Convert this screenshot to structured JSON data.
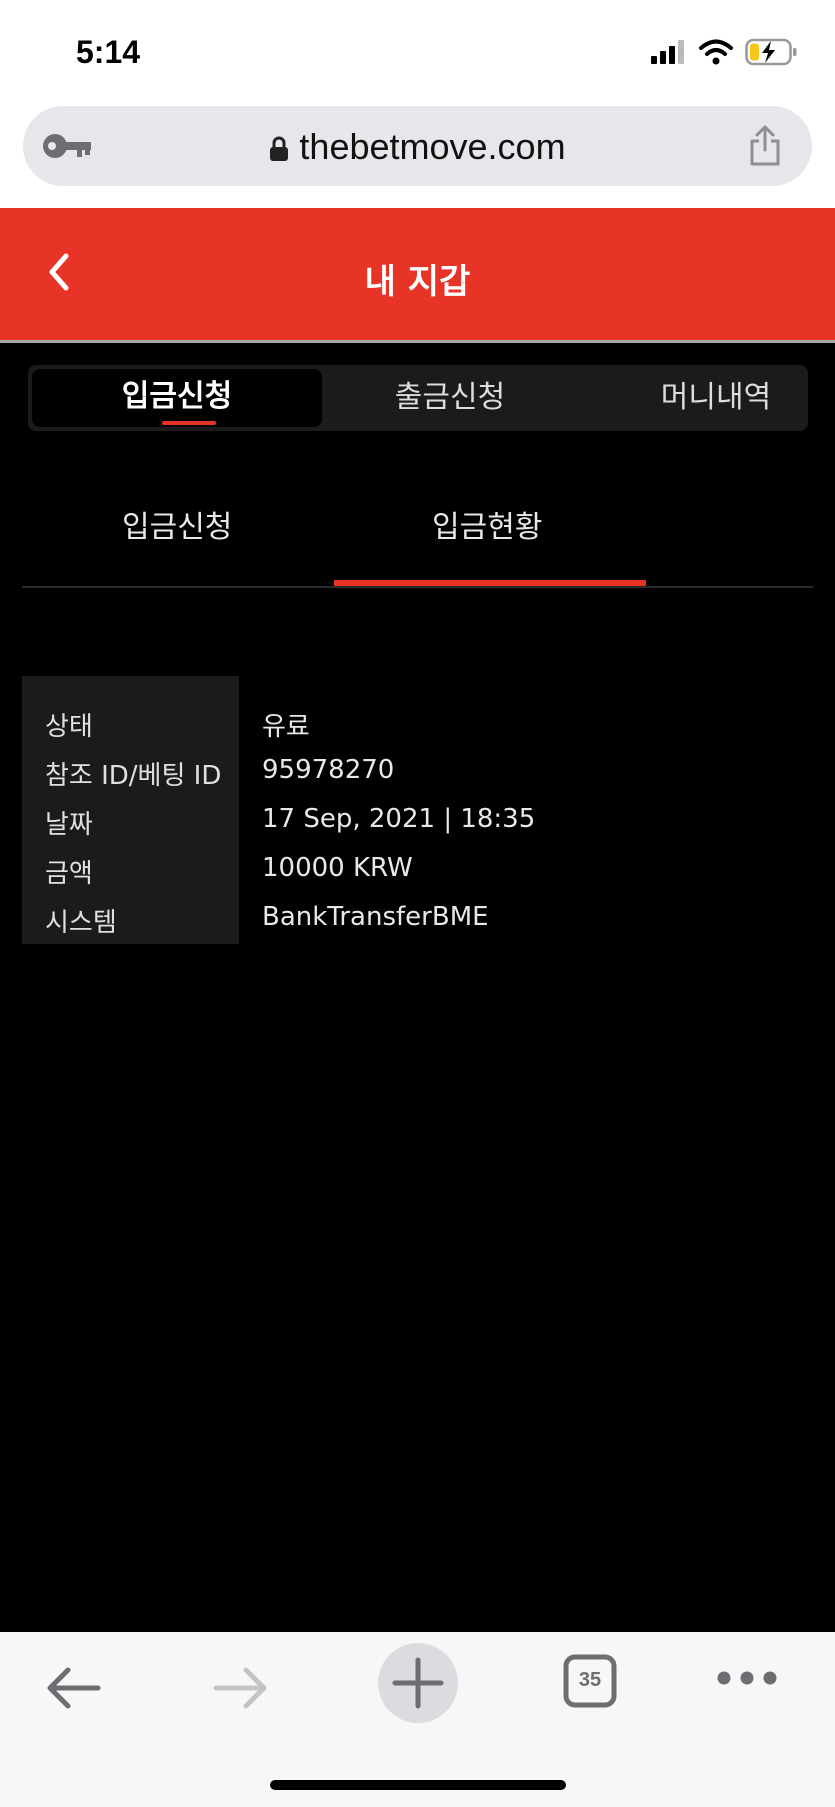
{
  "status_bar": {
    "time": "5:14"
  },
  "browser": {
    "url": "thebetmove.com",
    "tab_count": "35"
  },
  "header": {
    "title": "내 지갑"
  },
  "tabs": [
    {
      "label": "입금신청",
      "active": true
    },
    {
      "label": "출금신청",
      "active": false
    },
    {
      "label": "머니내역",
      "active": false
    }
  ],
  "subtabs": [
    {
      "label": "입금신청",
      "active": false
    },
    {
      "label": "입금현황",
      "active": true
    }
  ],
  "info": [
    {
      "label": "상태",
      "value": "유료"
    },
    {
      "label": "참조 ID/베팅 ID",
      "value": "95978270"
    },
    {
      "label": "날짜",
      "value": "17 Sep, 2021 | 18:35"
    },
    {
      "label": "금액",
      "value": "10000 KRW"
    },
    {
      "label": "시스템",
      "value": "BankTransferBME"
    }
  ],
  "colors": {
    "accent": "#e83426",
    "background": "#000000",
    "panel": "#1b1b1e"
  }
}
